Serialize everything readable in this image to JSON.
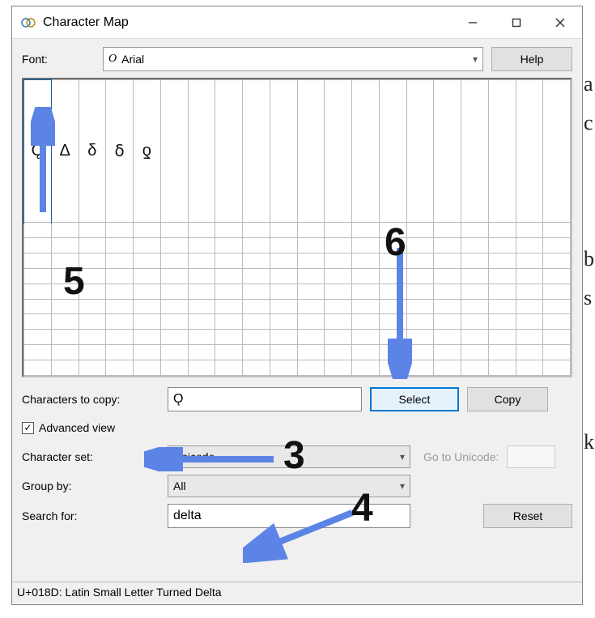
{
  "window": {
    "title": "Character Map"
  },
  "font_row": {
    "label": "Font:",
    "font_icon": "O",
    "font_name": "Arial",
    "help_label": "Help"
  },
  "grid": {
    "cols": 20,
    "rows": 11,
    "chars": [
      "Ǫ",
      "Δ",
      "δ",
      "ẟ",
      "ƍ"
    ],
    "selected_index": 0
  },
  "copy_row": {
    "label": "Characters to copy:",
    "value": "Ǫ",
    "select_label": "Select",
    "copy_label": "Copy"
  },
  "advanced": {
    "label": "Advanced view",
    "checked": true
  },
  "charset_row": {
    "label": "Character set:",
    "value": "Unicode",
    "goto_label": "Go to Unicode:"
  },
  "groupby_row": {
    "label": "Group by:",
    "value": "All"
  },
  "search_row": {
    "label": "Search for:",
    "value": "delta",
    "reset_label": "Reset"
  },
  "statusbar": {
    "text": "U+018D: Latin Small Letter Turned Delta"
  },
  "annotations": {
    "n3": "3",
    "n4": "4",
    "n5": "5",
    "n6": "6"
  },
  "bg_letters": [
    "a",
    "c",
    "b",
    "s",
    "k"
  ]
}
